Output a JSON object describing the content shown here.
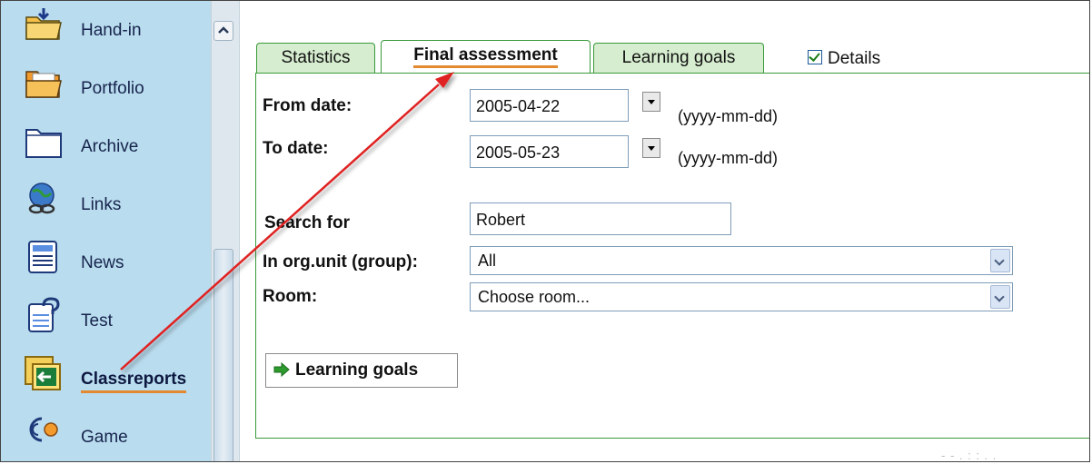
{
  "sidebar": {
    "items": [
      {
        "label": "Hand-in",
        "icon": "hand-in-folder-icon"
      },
      {
        "label": "Portfolio",
        "icon": "portfolio-folder-icon"
      },
      {
        "label": "Archive",
        "icon": "archive-folder-icon"
      },
      {
        "label": "Links",
        "icon": "links-globe-icon"
      },
      {
        "label": "News",
        "icon": "news-document-icon"
      },
      {
        "label": "Test",
        "icon": "test-question-icon"
      },
      {
        "label": "Classreports",
        "icon": "classreports-icon",
        "active": true
      },
      {
        "label": "Game",
        "icon": "game-icon"
      }
    ]
  },
  "tabs": [
    {
      "label": "Statistics"
    },
    {
      "label": "Final assessment",
      "active": true
    },
    {
      "label": "Learning goals"
    }
  ],
  "details": {
    "label": "Details",
    "checked": true
  },
  "form": {
    "from_label": "From date:",
    "from_value": "2005-04-22",
    "to_label": "To date:",
    "to_value": "2005-05-23",
    "date_hint": "(yyyy-mm-dd)",
    "search_label": "Search for",
    "search_value": "Robert",
    "orgunit_label": "In org.unit (group):",
    "orgunit_value": "All",
    "room_label": "Room:",
    "room_value": "Choose room..."
  },
  "action_button": {
    "label": "Learning goals"
  },
  "colors": {
    "sidebar_bg": "#b9dcee",
    "tab_border": "#3a9a3a",
    "tab_bg": "#d6edcf",
    "underline_accent": "#e3892f",
    "annotation_arrow": "#e02020"
  }
}
